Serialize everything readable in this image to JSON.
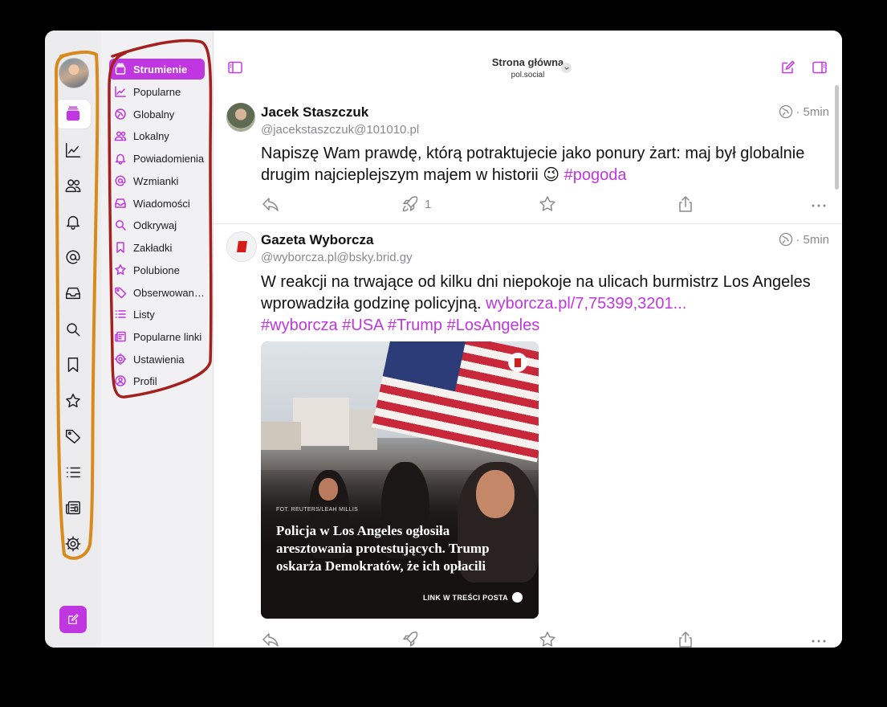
{
  "header": {
    "title": "Strona główna",
    "subtitle": "pol.social"
  },
  "rail": {
    "icons": [
      "timeline-icon",
      "trending-icon",
      "people-icon",
      "bell-icon",
      "at-icon",
      "inbox-icon",
      "search-icon",
      "bookmark-icon",
      "star-icon",
      "tag-icon",
      "list-icon",
      "newspaper-icon",
      "gear-icon"
    ]
  },
  "sidebar": {
    "items": [
      {
        "label": "Strumienie",
        "icon": "timeline-icon"
      },
      {
        "label": "Popularne",
        "icon": "trending-icon"
      },
      {
        "label": "Globalny",
        "icon": "globe-icon"
      },
      {
        "label": "Lokalny",
        "icon": "people-icon"
      },
      {
        "label": "Powiadomienia",
        "icon": "bell-icon"
      },
      {
        "label": "Wzmianki",
        "icon": "at-icon"
      },
      {
        "label": "Wiadomości",
        "icon": "inbox-icon"
      },
      {
        "label": "Odkrywaj",
        "icon": "search-icon"
      },
      {
        "label": "Zakładki",
        "icon": "bookmark-icon"
      },
      {
        "label": "Polubione",
        "icon": "star-icon"
      },
      {
        "label": "Obserwowane tagi",
        "icon": "tag-icon"
      },
      {
        "label": "Listy",
        "icon": "list-icon"
      },
      {
        "label": "Popularne linki",
        "icon": "newspaper-icon"
      },
      {
        "label": "Ustawienia",
        "icon": "gear-icon"
      },
      {
        "label": "Profil",
        "icon": "profile-icon"
      }
    ]
  },
  "posts": [
    {
      "author": "Jacek Staszczuk",
      "handle": "@jacekstaszczuk@101010.pl",
      "time": "· 5min",
      "text": "Napiszę Wam prawdę, którą potraktujecie jako ponury żart: maj był globalnie drugim najcieplejszym majem w historii 😉",
      "tag": "#pogoda",
      "boosts": "1"
    },
    {
      "author": "Gazeta Wyborcza",
      "handle": "@wyborcza.pl@bsky.brid.gy",
      "time": "· 5min",
      "text": "W reakcji na trwające od kilku dni niepokoje na ulicach burmistrz Los Angeles wprowadziła godzinę policyjną.",
      "link": "wyborcza.pl/7,75399,3201...",
      "tags": "#wyborcza #USA #Trump #LosAngeles",
      "media": {
        "source": "FOT. REUTERS/LEAH MILLIS",
        "caption": "Policja w Los Angeles ogłosiła aresztowania protestujących. Trump oskarża Demokratów, że ich opłacili",
        "link_label": "LINK W TREŚCI POSTA"
      }
    }
  ],
  "colors": {
    "accent": "#c036e0",
    "annotation_orange": "#d98a1c",
    "annotation_red": "#a3201e"
  }
}
